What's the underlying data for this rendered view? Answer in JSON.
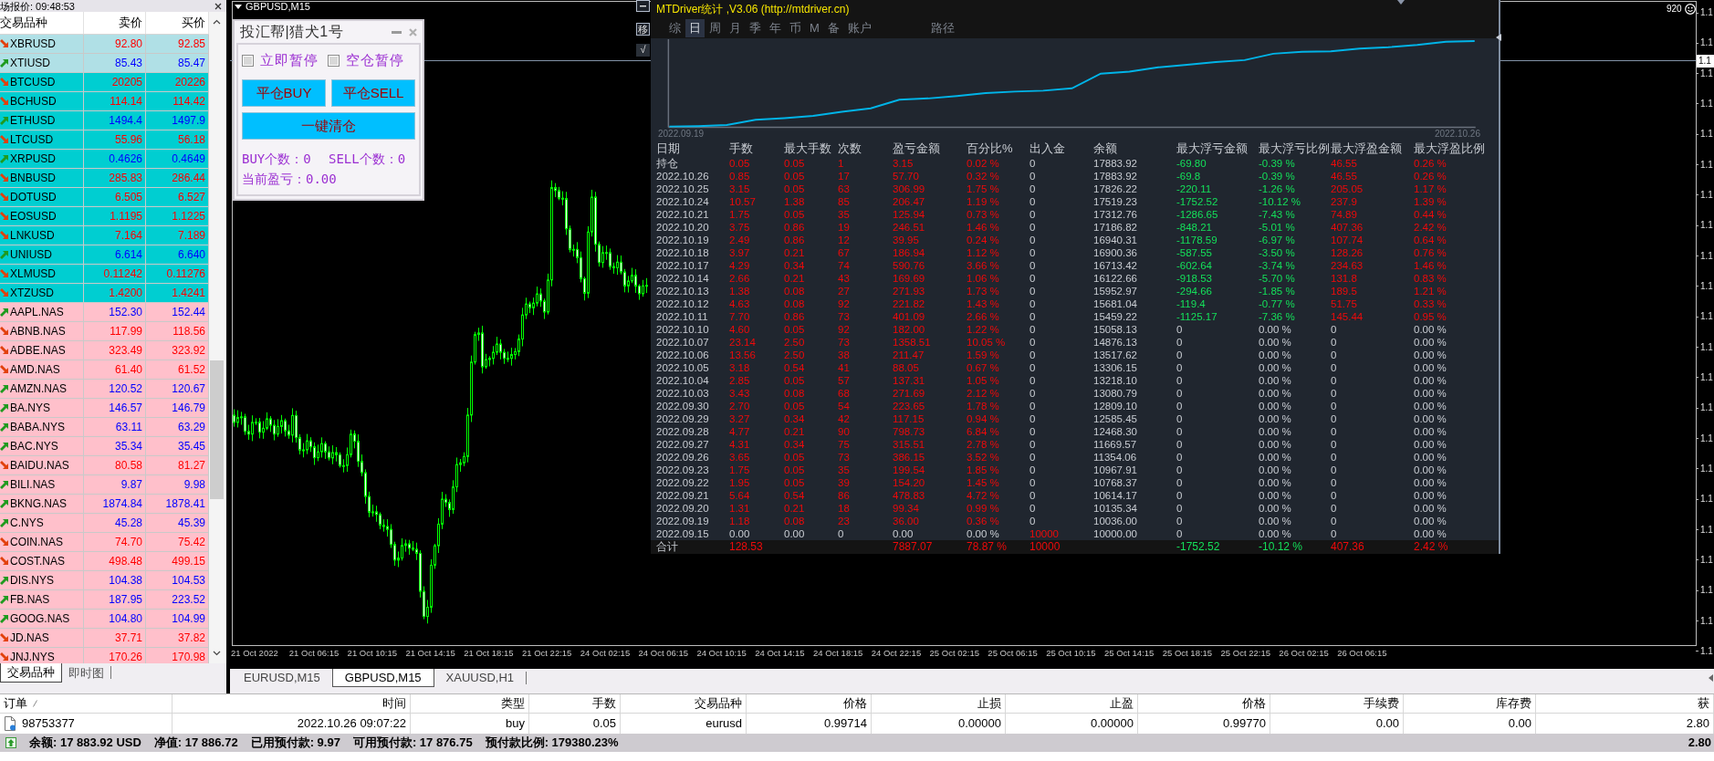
{
  "market_watch": {
    "title": "场报价: 09:48:53",
    "columns": [
      "交易品种",
      "卖价",
      "买价"
    ],
    "rows": [
      {
        "symbol": "XBRUSD",
        "bid": "92.80",
        "ask": "92.85",
        "rising": false,
        "color": "#b0e0e6"
      },
      {
        "symbol": "XTIUSD",
        "bid": "85.43",
        "ask": "85.47",
        "rising": true,
        "color": "#b0e0e6"
      },
      {
        "symbol": "BTCUSD",
        "bid": "20205",
        "ask": "20226",
        "rising": false,
        "color": "#00ced1"
      },
      {
        "symbol": "BCHUSD",
        "bid": "114.14",
        "ask": "114.42",
        "rising": false,
        "color": "#00ced1"
      },
      {
        "symbol": "ETHUSD",
        "bid": "1494.4",
        "ask": "1497.9",
        "rising": true,
        "color": "#00ced1"
      },
      {
        "symbol": "LTCUSD",
        "bid": "55.96",
        "ask": "56.18",
        "rising": false,
        "color": "#00ced1"
      },
      {
        "symbol": "XRPUSD",
        "bid": "0.4626",
        "ask": "0.4649",
        "rising": true,
        "color": "#00ced1"
      },
      {
        "symbol": "BNBUSD",
        "bid": "285.83",
        "ask": "286.44",
        "rising": false,
        "color": "#00ced1"
      },
      {
        "symbol": "DOTUSD",
        "bid": "6.505",
        "ask": "6.527",
        "rising": false,
        "color": "#00ced1"
      },
      {
        "symbol": "EOSUSD",
        "bid": "1.1195",
        "ask": "1.1225",
        "rising": false,
        "color": "#00ced1"
      },
      {
        "symbol": "LNKUSD",
        "bid": "7.164",
        "ask": "7.189",
        "rising": false,
        "color": "#00ced1"
      },
      {
        "symbol": "UNIUSD",
        "bid": "6.614",
        "ask": "6.640",
        "rising": true,
        "color": "#00ced1"
      },
      {
        "symbol": "XLMUSD",
        "bid": "0.11242",
        "ask": "0.11276",
        "rising": false,
        "color": "#00ced1"
      },
      {
        "symbol": "XTZUSD",
        "bid": "1.4200",
        "ask": "1.4241",
        "rising": false,
        "color": "#00ced1"
      },
      {
        "symbol": "AAPL.NAS",
        "bid": "152.30",
        "ask": "152.44",
        "rising": true,
        "color": "#ffc0cb"
      },
      {
        "symbol": "ABNB.NAS",
        "bid": "117.99",
        "ask": "118.56",
        "rising": false,
        "color": "#ffc0cb"
      },
      {
        "symbol": "ADBE.NAS",
        "bid": "323.49",
        "ask": "323.92",
        "rising": false,
        "color": "#ffc0cb"
      },
      {
        "symbol": "AMD.NAS",
        "bid": "61.40",
        "ask": "61.52",
        "rising": false,
        "color": "#ffc0cb"
      },
      {
        "symbol": "AMZN.NAS",
        "bid": "120.52",
        "ask": "120.67",
        "rising": true,
        "color": "#ffc0cb"
      },
      {
        "symbol": "BA.NYS",
        "bid": "146.57",
        "ask": "146.79",
        "rising": true,
        "color": "#ffc0cb"
      },
      {
        "symbol": "BABA.NYS",
        "bid": "63.11",
        "ask": "63.29",
        "rising": true,
        "color": "#ffc0cb"
      },
      {
        "symbol": "BAC.NYS",
        "bid": "35.34",
        "ask": "35.45",
        "rising": true,
        "color": "#ffc0cb"
      },
      {
        "symbol": "BAIDU.NAS",
        "bid": "80.58",
        "ask": "81.27",
        "rising": false,
        "color": "#ffc0cb"
      },
      {
        "symbol": "BILI.NAS",
        "bid": "9.87",
        "ask": "9.98",
        "rising": true,
        "color": "#ffc0cb"
      },
      {
        "symbol": "BKNG.NAS",
        "bid": "1874.84",
        "ask": "1878.41",
        "rising": true,
        "color": "#ffc0cb"
      },
      {
        "symbol": "C.NYS",
        "bid": "45.28",
        "ask": "45.39",
        "rising": true,
        "color": "#ffc0cb"
      },
      {
        "symbol": "COIN.NAS",
        "bid": "74.70",
        "ask": "75.42",
        "rising": false,
        "color": "#ffc0cb"
      },
      {
        "symbol": "COST.NAS",
        "bid": "498.48",
        "ask": "499.15",
        "rising": false,
        "color": "#ffc0cb"
      },
      {
        "symbol": "DIS.NYS",
        "bid": "104.38",
        "ask": "104.53",
        "rising": true,
        "color": "#ffc0cb"
      },
      {
        "symbol": "FB.NAS",
        "bid": "187.95",
        "ask": "223.52",
        "rising": true,
        "color": "#ffc0cb"
      },
      {
        "symbol": "GOOG.NAS",
        "bid": "104.80",
        "ask": "104.99",
        "rising": true,
        "color": "#ffc0cb"
      },
      {
        "symbol": "JD.NAS",
        "bid": "37.71",
        "ask": "37.82",
        "rising": false,
        "color": "#ffc0cb"
      },
      {
        "symbol": "JNJ.NYS",
        "bid": "170.26",
        "ask": "170.98",
        "rising": false,
        "color": "#ffc0cb"
      }
    ],
    "tabs": [
      {
        "label": "交易品种",
        "selected": true
      },
      {
        "label": "即时图",
        "selected": false
      }
    ]
  },
  "chart": {
    "title": "GBPUSD,M15",
    "info": "920",
    "current_price": "1.1",
    "price_labels": [
      "1.1",
      "1.1",
      "1.1",
      "1.1",
      "1.1",
      "1.1",
      "1.1",
      "1.1",
      "1.1",
      "1.1",
      "1.1",
      "1.1",
      "1.1",
      "1.1",
      "1.1",
      "1.1",
      "1.1",
      "1.1",
      "1.1",
      "1.1",
      "1.1",
      "1.1"
    ],
    "time_labels": [
      "21 Oct 2022",
      "21 Oct 06:15",
      "21 Oct 10:15",
      "21 Oct 14:15",
      "21 Oct 18:15",
      "21 Oct 22:15",
      "24 Oct 02:15",
      "24 Oct 06:15",
      "24 Oct 10:15",
      "24 Oct 14:15",
      "24 Oct 18:15",
      "24 Oct 22:15",
      "25 Oct 02:15",
      "25 Oct 06:15",
      "25 Oct 10:15",
      "25 Oct 14:15",
      "25 Oct 18:15",
      "25 Oct 22:15",
      "26 Oct 02:15",
      "26 Oct 06:15"
    ]
  },
  "trade_panel": {
    "title": "投汇帮|猎犬1号",
    "checkboxes": [
      {
        "label": "立即暂停",
        "checked": false
      },
      {
        "label": "空仓暂停",
        "checked": false
      }
    ],
    "buttons": [
      "平仓BUY",
      "平仓SELL"
    ],
    "wide_button": "一键清仓",
    "counts": [
      "BUY个数：0",
      "SELL个数：0"
    ],
    "pnl": "当前盈亏：0.00"
  },
  "stats_panel": {
    "title": "MTDriver统计 ,V3.06 (http://mtdriver.cn)",
    "side_buttons": [
      "移",
      "√"
    ],
    "tabs": [
      {
        "label": "综",
        "selected": false
      },
      {
        "label": "日",
        "selected": true
      },
      {
        "label": "周",
        "selected": false
      },
      {
        "label": "月",
        "selected": false
      },
      {
        "label": "季",
        "selected": false
      },
      {
        "label": "年",
        "selected": false
      },
      {
        "label": "币",
        "selected": false
      },
      {
        "label": "M",
        "selected": false
      },
      {
        "label": "备",
        "selected": false
      },
      {
        "label": "账户",
        "selected": false
      },
      {
        "label": "路径",
        "selected": false
      }
    ],
    "curve_start": "2022.09.19",
    "curve_end": "2022.10.26",
    "columns": [
      "日期",
      "手数",
      "最大手数",
      "次数",
      "盈亏金额",
      "百分比%",
      "出入金",
      "余额",
      "最大浮亏金额",
      "最大浮亏比例",
      "最大浮盈金额",
      "最大浮盈比例"
    ],
    "rows": [
      {
        "kind": "float",
        "cells": [
          "持仓",
          "0.05",
          "0.05",
          "1",
          "3.15",
          "0.02 %",
          "0",
          "17883.92",
          "-69.80",
          "-0.39 %",
          "46.55",
          "0.26 %"
        ]
      },
      {
        "kind": "float",
        "cells": [
          "2022.10.26",
          "0.85",
          "0.05",
          "17",
          "57.70",
          "0.32 %",
          "0",
          "17883.92",
          "-69.8",
          "-0.39 %",
          "46.55",
          "0.26 %"
        ]
      },
      {
        "kind": "float",
        "cells": [
          "2022.10.25",
          "3.15",
          "0.05",
          "63",
          "306.99",
          "1.75 %",
          "0",
          "17826.22",
          "-220.11",
          "-1.26 %",
          "205.05",
          "1.17 %"
        ]
      },
      {
        "kind": "float",
        "cells": [
          "2022.10.24",
          "10.57",
          "1.38",
          "85",
          "206.47",
          "1.19 %",
          "0",
          "17519.23",
          "-1752.52",
          "-10.12 %",
          "237.9",
          "1.39 %"
        ]
      },
      {
        "kind": "float",
        "cells": [
          "2022.10.21",
          "1.75",
          "0.05",
          "35",
          "125.94",
          "0.73 %",
          "0",
          "17312.76",
          "-1286.65",
          "-7.43 %",
          "74.89",
          "0.44 %"
        ]
      },
      {
        "kind": "float",
        "cells": [
          "2022.10.20",
          "3.75",
          "0.86",
          "19",
          "246.51",
          "1.46 %",
          "0",
          "17186.82",
          "-848.21",
          "-5.01 %",
          "407.36",
          "2.42 %"
        ]
      },
      {
        "kind": "float",
        "cells": [
          "2022.10.19",
          "2.49",
          "0.86",
          "12",
          "39.95",
          "0.24 %",
          "0",
          "16940.31",
          "-1178.59",
          "-6.97 %",
          "107.74",
          "0.64 %"
        ]
      },
      {
        "kind": "float",
        "cells": [
          "2022.10.18",
          "3.97",
          "0.21",
          "67",
          "186.94",
          "1.12 %",
          "0",
          "16900.36",
          "-587.55",
          "-3.50 %",
          "128.26",
          "0.76 %"
        ]
      },
      {
        "kind": "float",
        "cells": [
          "2022.10.17",
          "4.29",
          "0.34",
          "74",
          "590.76",
          "3.66 %",
          "0",
          "16713.42",
          "-602.64",
          "-3.74 %",
          "234.63",
          "1.46 %"
        ]
      },
      {
        "kind": "float",
        "cells": [
          "2022.10.14",
          "2.66",
          "0.21",
          "43",
          "169.69",
          "1.06 %",
          "0",
          "16122.66",
          "-918.53",
          "-5.70 %",
          "131.8",
          "0.83 %"
        ]
      },
      {
        "kind": "float",
        "cells": [
          "2022.10.13",
          "1.38",
          "0.08",
          "27",
          "271.93",
          "1.73 %",
          "0",
          "15952.97",
          "-294.66",
          "-1.85 %",
          "189.5",
          "1.21 %"
        ]
      },
      {
        "kind": "float",
        "cells": [
          "2022.10.12",
          "4.63",
          "0.08",
          "92",
          "221.82",
          "1.43 %",
          "0",
          "15681.04",
          "-119.4",
          "-0.77 %",
          "51.75",
          "0.33 %"
        ]
      },
      {
        "kind": "float",
        "cells": [
          "2022.10.11",
          "7.70",
          "0.86",
          "73",
          "401.09",
          "2.66 %",
          "0",
          "15459.22",
          "-1125.17",
          "-7.36 %",
          "145.44",
          "0.95 %"
        ]
      },
      {
        "kind": "flat",
        "cells": [
          "2022.10.10",
          "4.60",
          "0.05",
          "92",
          "182.00",
          "1.22 %",
          "0",
          "15058.13",
          "0",
          "0.00 %",
          "0",
          "0.00 %"
        ]
      },
      {
        "kind": "flat",
        "cells": [
          "2022.10.07",
          "23.14",
          "2.50",
          "73",
          "1358.51",
          "10.05 %",
          "0",
          "14876.13",
          "0",
          "0.00 %",
          "0",
          "0.00 %"
        ]
      },
      {
        "kind": "flat",
        "cells": [
          "2022.10.06",
          "13.56",
          "2.50",
          "38",
          "211.47",
          "1.59 %",
          "0",
          "13517.62",
          "0",
          "0.00 %",
          "0",
          "0.00 %"
        ]
      },
      {
        "kind": "flat",
        "cells": [
          "2022.10.05",
          "3.18",
          "0.54",
          "41",
          "88.05",
          "0.67 %",
          "0",
          "13306.15",
          "0",
          "0.00 %",
          "0",
          "0.00 %"
        ]
      },
      {
        "kind": "flat",
        "cells": [
          "2022.10.04",
          "2.85",
          "0.05",
          "57",
          "137.31",
          "1.05 %",
          "0",
          "13218.10",
          "0",
          "0.00 %",
          "0",
          "0.00 %"
        ]
      },
      {
        "kind": "flat",
        "cells": [
          "2022.10.03",
          "3.43",
          "0.08",
          "68",
          "271.69",
          "2.12 %",
          "0",
          "13080.79",
          "0",
          "0.00 %",
          "0",
          "0.00 %"
        ]
      },
      {
        "kind": "flat",
        "cells": [
          "2022.09.30",
          "2.70",
          "0.05",
          "54",
          "223.65",
          "1.78 %",
          "0",
          "12809.10",
          "0",
          "0.00 %",
          "0",
          "0.00 %"
        ]
      },
      {
        "kind": "flat",
        "cells": [
          "2022.09.29",
          "3.27",
          "0.34",
          "42",
          "117.15",
          "0.94 %",
          "0",
          "12585.45",
          "0",
          "0.00 %",
          "0",
          "0.00 %"
        ]
      },
      {
        "kind": "flat",
        "cells": [
          "2022.09.28",
          "4.77",
          "0.21",
          "90",
          "798.73",
          "6.84 %",
          "0",
          "12468.30",
          "0",
          "0.00 %",
          "0",
          "0.00 %"
        ]
      },
      {
        "kind": "flat",
        "cells": [
          "2022.09.27",
          "4.31",
          "0.34",
          "75",
          "315.51",
          "2.78 %",
          "0",
          "11669.57",
          "0",
          "0.00 %",
          "0",
          "0.00 %"
        ]
      },
      {
        "kind": "flat",
        "cells": [
          "2022.09.26",
          "3.65",
          "0.05",
          "73",
          "386.15",
          "3.52 %",
          "0",
          "11354.06",
          "0",
          "0.00 %",
          "0",
          "0.00 %"
        ]
      },
      {
        "kind": "flat",
        "cells": [
          "2022.09.23",
          "1.75",
          "0.05",
          "35",
          "199.54",
          "1.85 %",
          "0",
          "10967.91",
          "0",
          "0.00 %",
          "0",
          "0.00 %"
        ]
      },
      {
        "kind": "flat",
        "cells": [
          "2022.09.22",
          "1.95",
          "0.05",
          "39",
          "154.20",
          "1.45 %",
          "0",
          "10768.37",
          "0",
          "0.00 %",
          "0",
          "0.00 %"
        ]
      },
      {
        "kind": "flat",
        "cells": [
          "2022.09.21",
          "5.64",
          "0.54",
          "86",
          "478.83",
          "4.72 %",
          "0",
          "10614.17",
          "0",
          "0.00 %",
          "0",
          "0.00 %"
        ]
      },
      {
        "kind": "flat",
        "cells": [
          "2022.09.20",
          "1.31",
          "0.21",
          "18",
          "99.34",
          "0.99 %",
          "0",
          "10135.34",
          "0",
          "0.00 %",
          "0",
          "0.00 %"
        ]
      },
      {
        "kind": "flat",
        "cells": [
          "2022.09.19",
          "1.18",
          "0.08",
          "23",
          "36.00",
          "0.36 %",
          "0",
          "10036.00",
          "0",
          "0.00 %",
          "0",
          "0.00 %"
        ]
      },
      {
        "kind": "deposit",
        "cells": [
          "2022.09.15",
          "0.00",
          "0.00",
          "0",
          "0.00",
          "0.00 %",
          "10000",
          "10000.00",
          "0",
          "0.00 %",
          "0",
          "0.00 %"
        ]
      },
      {
        "kind": "total",
        "cells": [
          "合计",
          "128.53",
          "",
          "",
          "7887.07",
          "78.87 %",
          "10000",
          "",
          "-1752.52",
          "-10.12 %",
          "407.36",
          "2.42 %"
        ]
      }
    ]
  },
  "chart_tabs": [
    {
      "label": "EURUSD,M15",
      "selected": false
    },
    {
      "label": "GBPUSD,M15",
      "selected": true
    },
    {
      "label": "XAUUSD,H1",
      "selected": false
    }
  ],
  "terminal": {
    "columns": [
      "订单",
      "时间",
      "类型",
      "手数",
      "交易品种",
      "价格",
      "止损",
      "止盈",
      "价格",
      "手续费",
      "库存费",
      "获"
    ],
    "orders": [
      {
        "cells": [
          "98753377",
          "2022.10.26 09:07:22",
          "buy",
          "0.05",
          "eurusd",
          "0.99714",
          "0.00000",
          "0.00000",
          "0.99770",
          "0.00",
          "0.00",
          "2.80"
        ]
      }
    ],
    "summary": [
      "余额: 17 883.92 USD",
      "净值: 17 886.72",
      "已用预付款: 9.97",
      "可用预付款: 17 876.75",
      "预付款比例: 179380.23%"
    ],
    "summary_profit": "2.80"
  }
}
